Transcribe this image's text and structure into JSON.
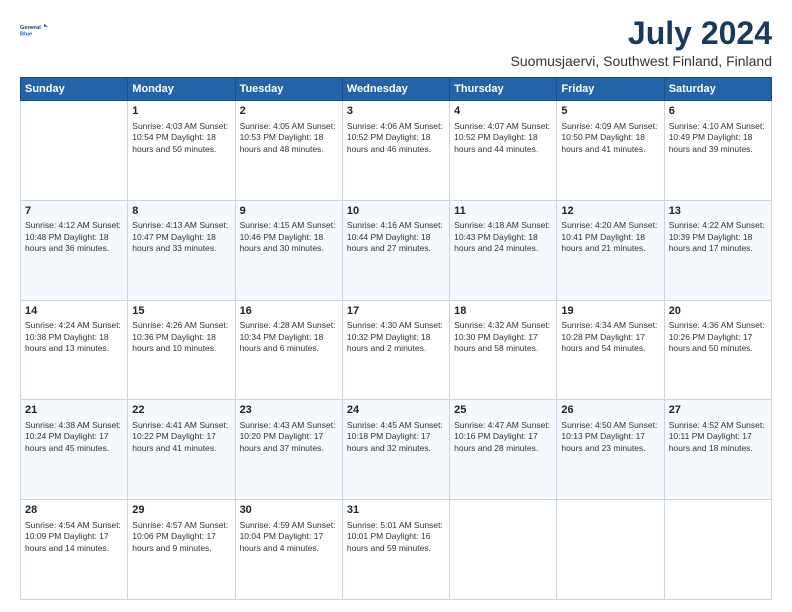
{
  "header": {
    "logo_line1": "General",
    "logo_line2": "Blue",
    "month_year": "July 2024",
    "location": "Suomusjaervi, Southwest Finland, Finland"
  },
  "weekdays": [
    "Sunday",
    "Monday",
    "Tuesday",
    "Wednesday",
    "Thursday",
    "Friday",
    "Saturday"
  ],
  "rows": [
    [
      {
        "day": "",
        "info": ""
      },
      {
        "day": "1",
        "info": "Sunrise: 4:03 AM\nSunset: 10:54 PM\nDaylight: 18 hours\nand 50 minutes."
      },
      {
        "day": "2",
        "info": "Sunrise: 4:05 AM\nSunset: 10:53 PM\nDaylight: 18 hours\nand 48 minutes."
      },
      {
        "day": "3",
        "info": "Sunrise: 4:06 AM\nSunset: 10:52 PM\nDaylight: 18 hours\nand 46 minutes."
      },
      {
        "day": "4",
        "info": "Sunrise: 4:07 AM\nSunset: 10:52 PM\nDaylight: 18 hours\nand 44 minutes."
      },
      {
        "day": "5",
        "info": "Sunrise: 4:09 AM\nSunset: 10:50 PM\nDaylight: 18 hours\nand 41 minutes."
      },
      {
        "day": "6",
        "info": "Sunrise: 4:10 AM\nSunset: 10:49 PM\nDaylight: 18 hours\nand 39 minutes."
      }
    ],
    [
      {
        "day": "7",
        "info": "Sunrise: 4:12 AM\nSunset: 10:48 PM\nDaylight: 18 hours\nand 36 minutes."
      },
      {
        "day": "8",
        "info": "Sunrise: 4:13 AM\nSunset: 10:47 PM\nDaylight: 18 hours\nand 33 minutes."
      },
      {
        "day": "9",
        "info": "Sunrise: 4:15 AM\nSunset: 10:46 PM\nDaylight: 18 hours\nand 30 minutes."
      },
      {
        "day": "10",
        "info": "Sunrise: 4:16 AM\nSunset: 10:44 PM\nDaylight: 18 hours\nand 27 minutes."
      },
      {
        "day": "11",
        "info": "Sunrise: 4:18 AM\nSunset: 10:43 PM\nDaylight: 18 hours\nand 24 minutes."
      },
      {
        "day": "12",
        "info": "Sunrise: 4:20 AM\nSunset: 10:41 PM\nDaylight: 18 hours\nand 21 minutes."
      },
      {
        "day": "13",
        "info": "Sunrise: 4:22 AM\nSunset: 10:39 PM\nDaylight: 18 hours\nand 17 minutes."
      }
    ],
    [
      {
        "day": "14",
        "info": "Sunrise: 4:24 AM\nSunset: 10:38 PM\nDaylight: 18 hours\nand 13 minutes."
      },
      {
        "day": "15",
        "info": "Sunrise: 4:26 AM\nSunset: 10:36 PM\nDaylight: 18 hours\nand 10 minutes."
      },
      {
        "day": "16",
        "info": "Sunrise: 4:28 AM\nSunset: 10:34 PM\nDaylight: 18 hours\nand 6 minutes."
      },
      {
        "day": "17",
        "info": "Sunrise: 4:30 AM\nSunset: 10:32 PM\nDaylight: 18 hours\nand 2 minutes."
      },
      {
        "day": "18",
        "info": "Sunrise: 4:32 AM\nSunset: 10:30 PM\nDaylight: 17 hours\nand 58 minutes."
      },
      {
        "day": "19",
        "info": "Sunrise: 4:34 AM\nSunset: 10:28 PM\nDaylight: 17 hours\nand 54 minutes."
      },
      {
        "day": "20",
        "info": "Sunrise: 4:36 AM\nSunset: 10:26 PM\nDaylight: 17 hours\nand 50 minutes."
      }
    ],
    [
      {
        "day": "21",
        "info": "Sunrise: 4:38 AM\nSunset: 10:24 PM\nDaylight: 17 hours\nand 45 minutes."
      },
      {
        "day": "22",
        "info": "Sunrise: 4:41 AM\nSunset: 10:22 PM\nDaylight: 17 hours\nand 41 minutes."
      },
      {
        "day": "23",
        "info": "Sunrise: 4:43 AM\nSunset: 10:20 PM\nDaylight: 17 hours\nand 37 minutes."
      },
      {
        "day": "24",
        "info": "Sunrise: 4:45 AM\nSunset: 10:18 PM\nDaylight: 17 hours\nand 32 minutes."
      },
      {
        "day": "25",
        "info": "Sunrise: 4:47 AM\nSunset: 10:16 PM\nDaylight: 17 hours\nand 28 minutes."
      },
      {
        "day": "26",
        "info": "Sunrise: 4:50 AM\nSunset: 10:13 PM\nDaylight: 17 hours\nand 23 minutes."
      },
      {
        "day": "27",
        "info": "Sunrise: 4:52 AM\nSunset: 10:11 PM\nDaylight: 17 hours\nand 18 minutes."
      }
    ],
    [
      {
        "day": "28",
        "info": "Sunrise: 4:54 AM\nSunset: 10:09 PM\nDaylight: 17 hours\nand 14 minutes."
      },
      {
        "day": "29",
        "info": "Sunrise: 4:57 AM\nSunset: 10:06 PM\nDaylight: 17 hours\nand 9 minutes."
      },
      {
        "day": "30",
        "info": "Sunrise: 4:59 AM\nSunset: 10:04 PM\nDaylight: 17 hours\nand 4 minutes."
      },
      {
        "day": "31",
        "info": "Sunrise: 5:01 AM\nSunset: 10:01 PM\nDaylight: 16 hours\nand 59 minutes."
      },
      {
        "day": "",
        "info": ""
      },
      {
        "day": "",
        "info": ""
      },
      {
        "day": "",
        "info": ""
      }
    ]
  ]
}
